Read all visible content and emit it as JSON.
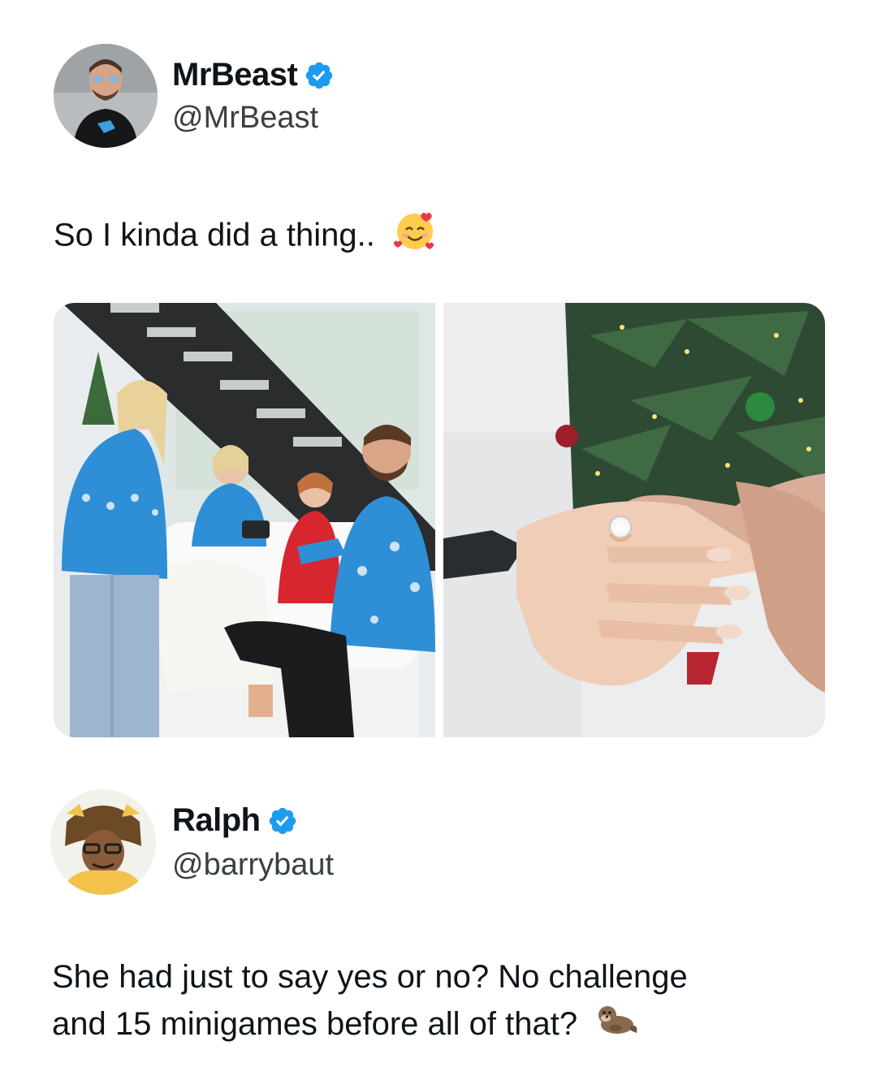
{
  "tweet1": {
    "author": {
      "display_name": "MrBeast",
      "handle": "@MrBeast",
      "verified": true
    },
    "text": "So I kinda did a thing..",
    "emoji": "smiling-face-with-hearts",
    "media": [
      {
        "kind": "photo",
        "subject": "proposal-living-room"
      },
      {
        "kind": "photo",
        "subject": "engagement-ring-hands"
      }
    ]
  },
  "tweet2": {
    "author": {
      "display_name": "Ralph",
      "handle": "@barrybaut",
      "verified": true
    },
    "text_line1": "She had just to say yes or no? No challenge",
    "text_line2": "and 15 minigames before all of that?",
    "emoji": "otter"
  },
  "colors": {
    "verified": "#1d9bf0",
    "text": "#0f1419",
    "handle": "#3a3f44",
    "sweater": "#2f8fd6"
  }
}
